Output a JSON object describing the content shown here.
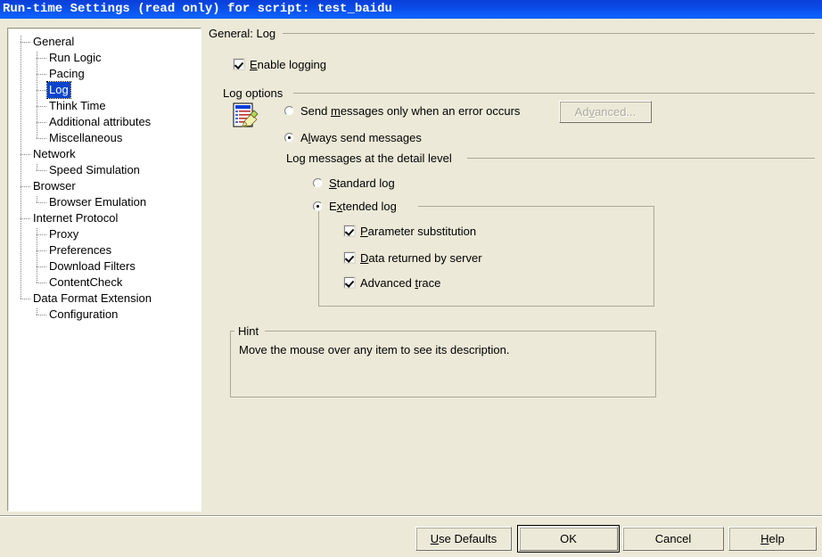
{
  "window": {
    "title": "Run-time Settings (read only) for script: test_baidu"
  },
  "sidebar": {
    "items": [
      {
        "label": "General",
        "level": 0,
        "selected": false
      },
      {
        "label": "Run Logic",
        "level": 1,
        "selected": false
      },
      {
        "label": "Pacing",
        "level": 1,
        "selected": false
      },
      {
        "label": "Log",
        "level": 1,
        "selected": true
      },
      {
        "label": "Think Time",
        "level": 1,
        "selected": false
      },
      {
        "label": "Additional attributes",
        "level": 1,
        "selected": false
      },
      {
        "label": "Miscellaneous",
        "level": 1,
        "selected": false
      },
      {
        "label": "Network",
        "level": 0,
        "selected": false
      },
      {
        "label": "Speed Simulation",
        "level": 1,
        "selected": false
      },
      {
        "label": "Browser",
        "level": 0,
        "selected": false
      },
      {
        "label": "Browser Emulation",
        "level": 1,
        "selected": false
      },
      {
        "label": "Internet Protocol",
        "level": 0,
        "selected": false
      },
      {
        "label": "Proxy",
        "level": 1,
        "selected": false
      },
      {
        "label": "Preferences",
        "level": 1,
        "selected": false
      },
      {
        "label": "Download Filters",
        "level": 1,
        "selected": false
      },
      {
        "label": "ContentCheck",
        "level": 1,
        "selected": false
      },
      {
        "label": "Data Format Extension",
        "level": 0,
        "selected": false
      },
      {
        "label": "Configuration",
        "level": 1,
        "selected": false
      }
    ]
  },
  "main": {
    "page_title": "General: Log",
    "enable_logging": {
      "label_pre": "",
      "mnemonic": "E",
      "label_post": "nable logging",
      "checked": true
    },
    "log_options": {
      "title": "Log options",
      "icon": "log-document-pencil-icon",
      "radios": [
        {
          "pre": "Send ",
          "mnemonic": "m",
          "post": "essages only when an error occurs",
          "checked": false
        },
        {
          "pre": "A",
          "mnemonic": "l",
          "post": "ways send messages",
          "checked": true
        }
      ],
      "advanced_button": {
        "pre": "Ad",
        "mnemonic": "v",
        "post": "anced...",
        "disabled": true
      },
      "detail_level": {
        "title": "Log messages at the detail level",
        "radios": [
          {
            "pre": "",
            "mnemonic": "S",
            "post": "tandard log",
            "checked": false
          },
          {
            "pre": "E",
            "mnemonic": "x",
            "post": "tended log",
            "checked": true
          }
        ],
        "checkboxes": [
          {
            "pre": "",
            "mnemonic": "P",
            "post": "arameter substitution",
            "checked": true
          },
          {
            "pre": "",
            "mnemonic": "D",
            "post": "ata returned by server",
            "checked": true
          },
          {
            "pre": "Advanced ",
            "mnemonic": "t",
            "post": "race",
            "checked": true
          }
        ]
      }
    },
    "hint": {
      "title": "Hint",
      "text": "Move the mouse over any item to see its description."
    }
  },
  "footer": {
    "buttons": [
      {
        "pre": "",
        "mnemonic": "U",
        "post": "se Defaults",
        "default": false,
        "name": "use-defaults-button"
      },
      {
        "pre": "OK",
        "mnemonic": "",
        "post": "",
        "default": true,
        "name": "ok-button"
      },
      {
        "pre": "Cancel",
        "mnemonic": "",
        "post": "",
        "default": false,
        "name": "cancel-button"
      },
      {
        "pre": "",
        "mnemonic": "H",
        "post": "elp",
        "default": false,
        "name": "help-button"
      }
    ]
  },
  "colors": {
    "dialog_background": "#ECE9D8",
    "titlebar_blue": "#0A4CE8",
    "selection_blue": "#0B44CC",
    "tree_background": "#FFFFFF",
    "group_border": "#ACA899",
    "disabled_text": "#ACA899"
  }
}
